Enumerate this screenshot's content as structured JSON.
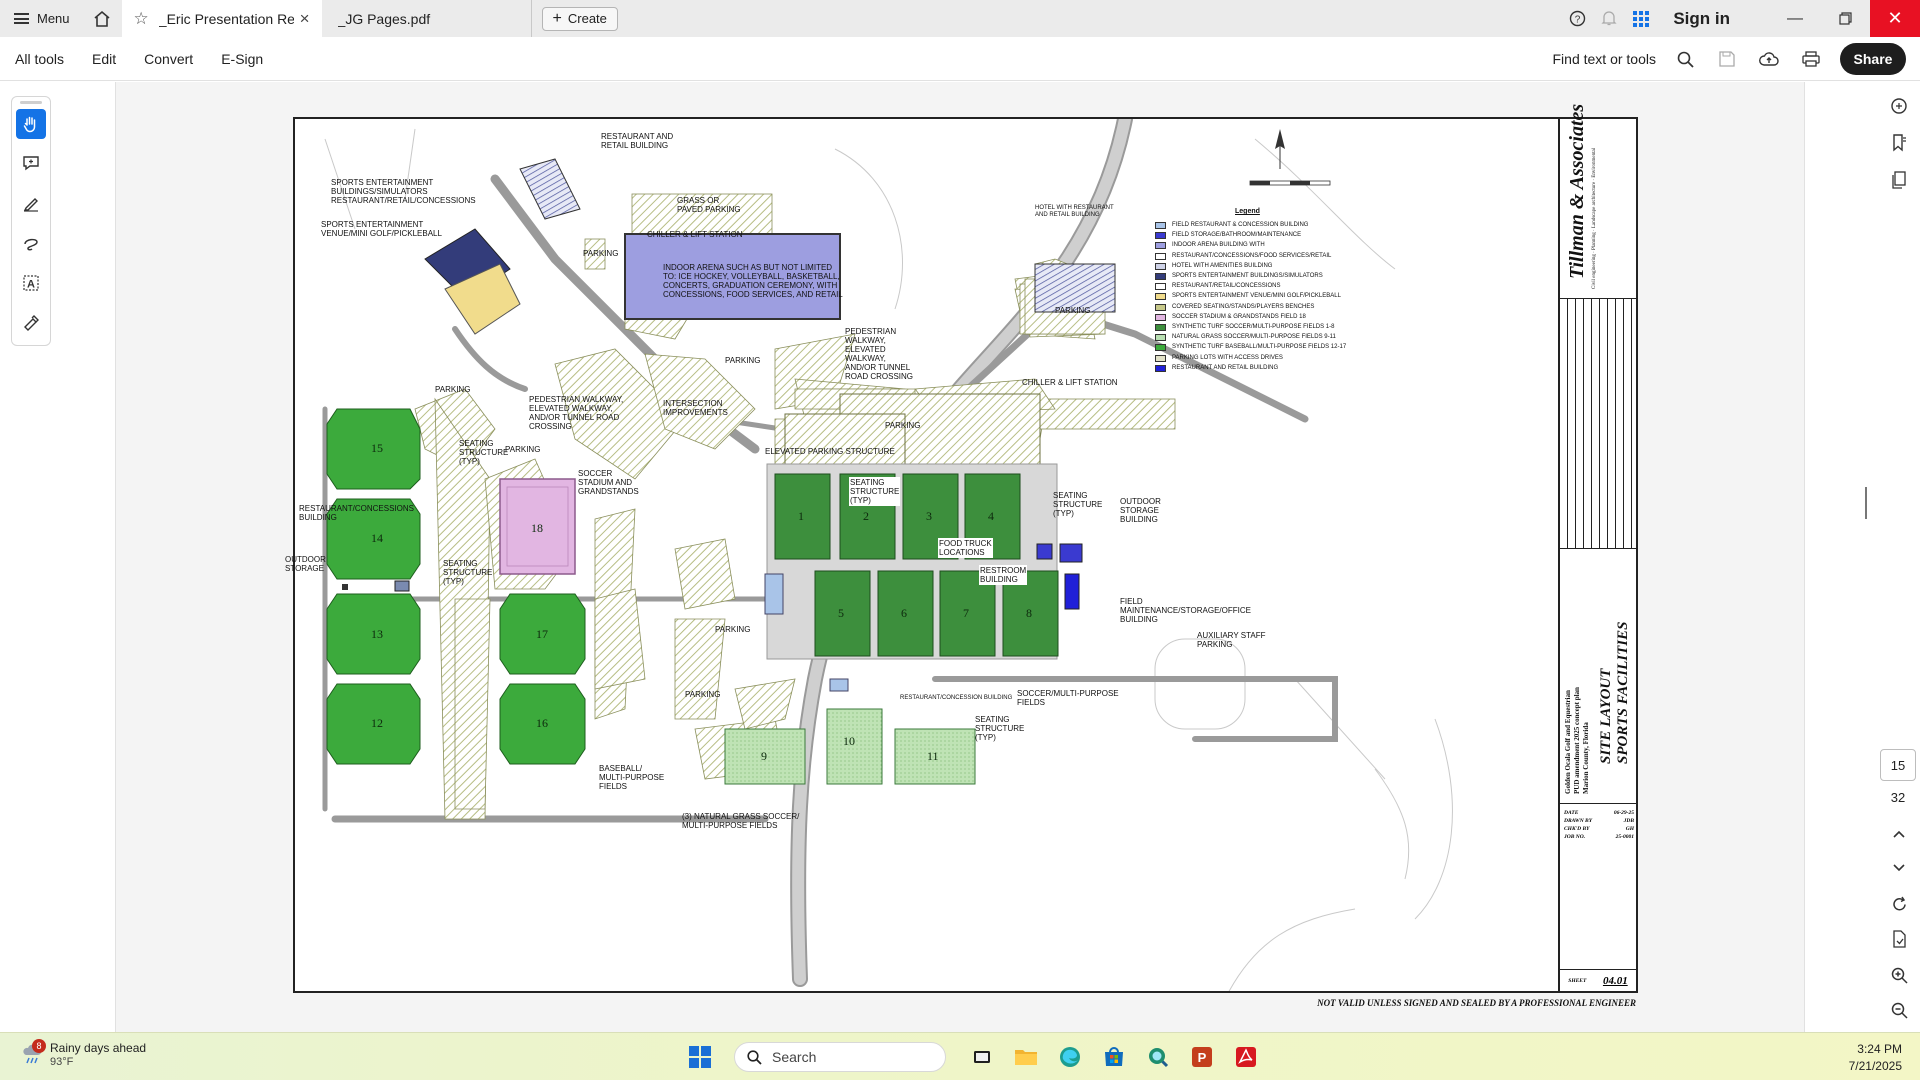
{
  "titlebar": {
    "menu_label": "Menu",
    "tabs": [
      {
        "label": "_Eric Presentation Revp..."
      },
      {
        "label": "_JG Pages.pdf"
      }
    ],
    "create_label": "Create",
    "signin_label": "Sign in"
  },
  "toolbar": {
    "items": [
      "All tools",
      "Edit",
      "Convert",
      "E-Sign"
    ],
    "find_label": "Find text or tools",
    "share_label": "Share"
  },
  "navigation": {
    "current_page": "15",
    "total_pages": "32"
  },
  "plan": {
    "labels": {
      "restaurant_retail": "Restaurant and\nretail building",
      "sports_ent_buildings": "Sports entertainment\nbuildings/simulators\nrestaurant/retail/concessions",
      "sports_ent_venue": "Sports entertainment\nvenue/mini golf/pickleball",
      "grass_paved_parking": "Grass or\npaved parking",
      "chiller_lift_1": "Chiller & lift station",
      "indoor_arena": "Indoor arena such as but not limited\nto: ice hockey, volleyball, basketball,\nconcerts, graduation ceremony, with\nconcessions, food services, and retail",
      "parking": "Parking",
      "hotel_amenities": "Hotel with restaurant\nand retail building",
      "pedestrian_walkway_1": "Pedestrian\nwalkway,\nelevated\nwalkway,\nand/or tunnel\nroad crossing",
      "chiller_lift_2": "Chiller & lift station",
      "pedestrian_walkway_2": "Pedestrian walkway,\nelevated walkway,\nand/or tunnel road\ncrossing",
      "intersection": "Intersection\nimprovements",
      "elevated_parking": "Elevated parking structure",
      "seating_typ": "Seating\nstructure\n(typ)",
      "soccer_stadium": "Soccer\nstadium and\ngrandstands",
      "restaurant_concessions": "Restaurant/concessions\nbuilding",
      "outdoor_storage_left": "Outdoor\nstorage",
      "food_truck": "Food truck\nlocations",
      "restroom": "Restroom\nbuilding",
      "outdoor_storage_right": "Outdoor\nstorage\nbuilding",
      "field_maintenance": "Field\nmaintenance/storage/office\nbuilding",
      "auxiliary_staff": "Auxiliary staff\nparking",
      "soccer_multipurpose": "Soccer/multi-purpose\nfields",
      "restaurant_concession_small": "Restaurant/concession building",
      "baseball_multipurpose": "Baseball/\nmulti-purpose\nfields",
      "natural_grass": "(3) Natural grass soccer/\nmulti-purpose fields"
    },
    "fields": [
      "1",
      "2",
      "3",
      "4",
      "5",
      "6",
      "7",
      "8",
      "9",
      "10",
      "11",
      "12",
      "13",
      "14",
      "15",
      "16",
      "17",
      "18"
    ],
    "legend_title": "Legend",
    "legend": [
      {
        "label": "Field restaurant & concession building",
        "color": "#a9c4e8"
      },
      {
        "label": "Field storage/bathroom/maintenance",
        "color": "#3a3ad0"
      },
      {
        "label": "Indoor arena building with",
        "color": "#9d9ee0"
      },
      {
        "label": "Restaurant/concessions/food services/retail",
        "color": "#ffffff"
      },
      {
        "label": "Hotel with amenities building",
        "color": "#cfd3e8"
      },
      {
        "label": "Sports entertainment buildings/simulators",
        "color": "#333c7a"
      },
      {
        "label": "Restaurant/retail/concessions",
        "color": "#ffffff"
      },
      {
        "label": "Sports entertainment venue/mini golf/pickleball",
        "color": "#f1dc8c"
      },
      {
        "label": "Covered seating/stands/players benches",
        "color": "#c7c98a"
      },
      {
        "label": "Soccer stadium & grandstands field 18",
        "color": "#e2b6e2"
      },
      {
        "label": "Synthetic turf soccer/multi-purpose fields 1-8",
        "color": "#3d8f3d"
      },
      {
        "label": "Natural grass soccer/multi-purpose fields 9-11",
        "color": "#b9e0b3"
      },
      {
        "label": "Synthetic turf baseball/multi-purpose fields 12-17",
        "color": "#3caa3c"
      },
      {
        "label": "Parking lots with access drives",
        "color": "#e2e2c8"
      },
      {
        "label": "Restaurant and retail building",
        "color": "#2020d8"
      }
    ],
    "title_block": {
      "firm": "Tillman & Associates",
      "firm_sub": "Civil engineering · Planning · Landscape architecture · Environmental",
      "project": "Golden Ocala Golf and Equestrian\nPUD amendment 2025 concept plan\nMarion County, Florida",
      "sheet_title": "Site layout\nsports facilities",
      "date_label": "Date",
      "date_value": "06-29-25",
      "drawn_label": "Drawn by",
      "drawn_value": "JDB",
      "chkd_label": "Chk'd by",
      "chkd_value": "GH",
      "job_label": "Job no.",
      "job_value": "25-0001",
      "sheet_label": "Sheet",
      "sheet_value": "04.01"
    },
    "disclaimer": "NOT VALID UNLESS SIGNED AND SEALED BY A PROFESSIONAL ENGINEER"
  },
  "taskbar": {
    "weather_title": "Rainy days ahead",
    "weather_temp": "93°F",
    "weather_badge": "8",
    "search_placeholder": "Search",
    "time": "3:24 PM",
    "date": "7/21/2025"
  }
}
